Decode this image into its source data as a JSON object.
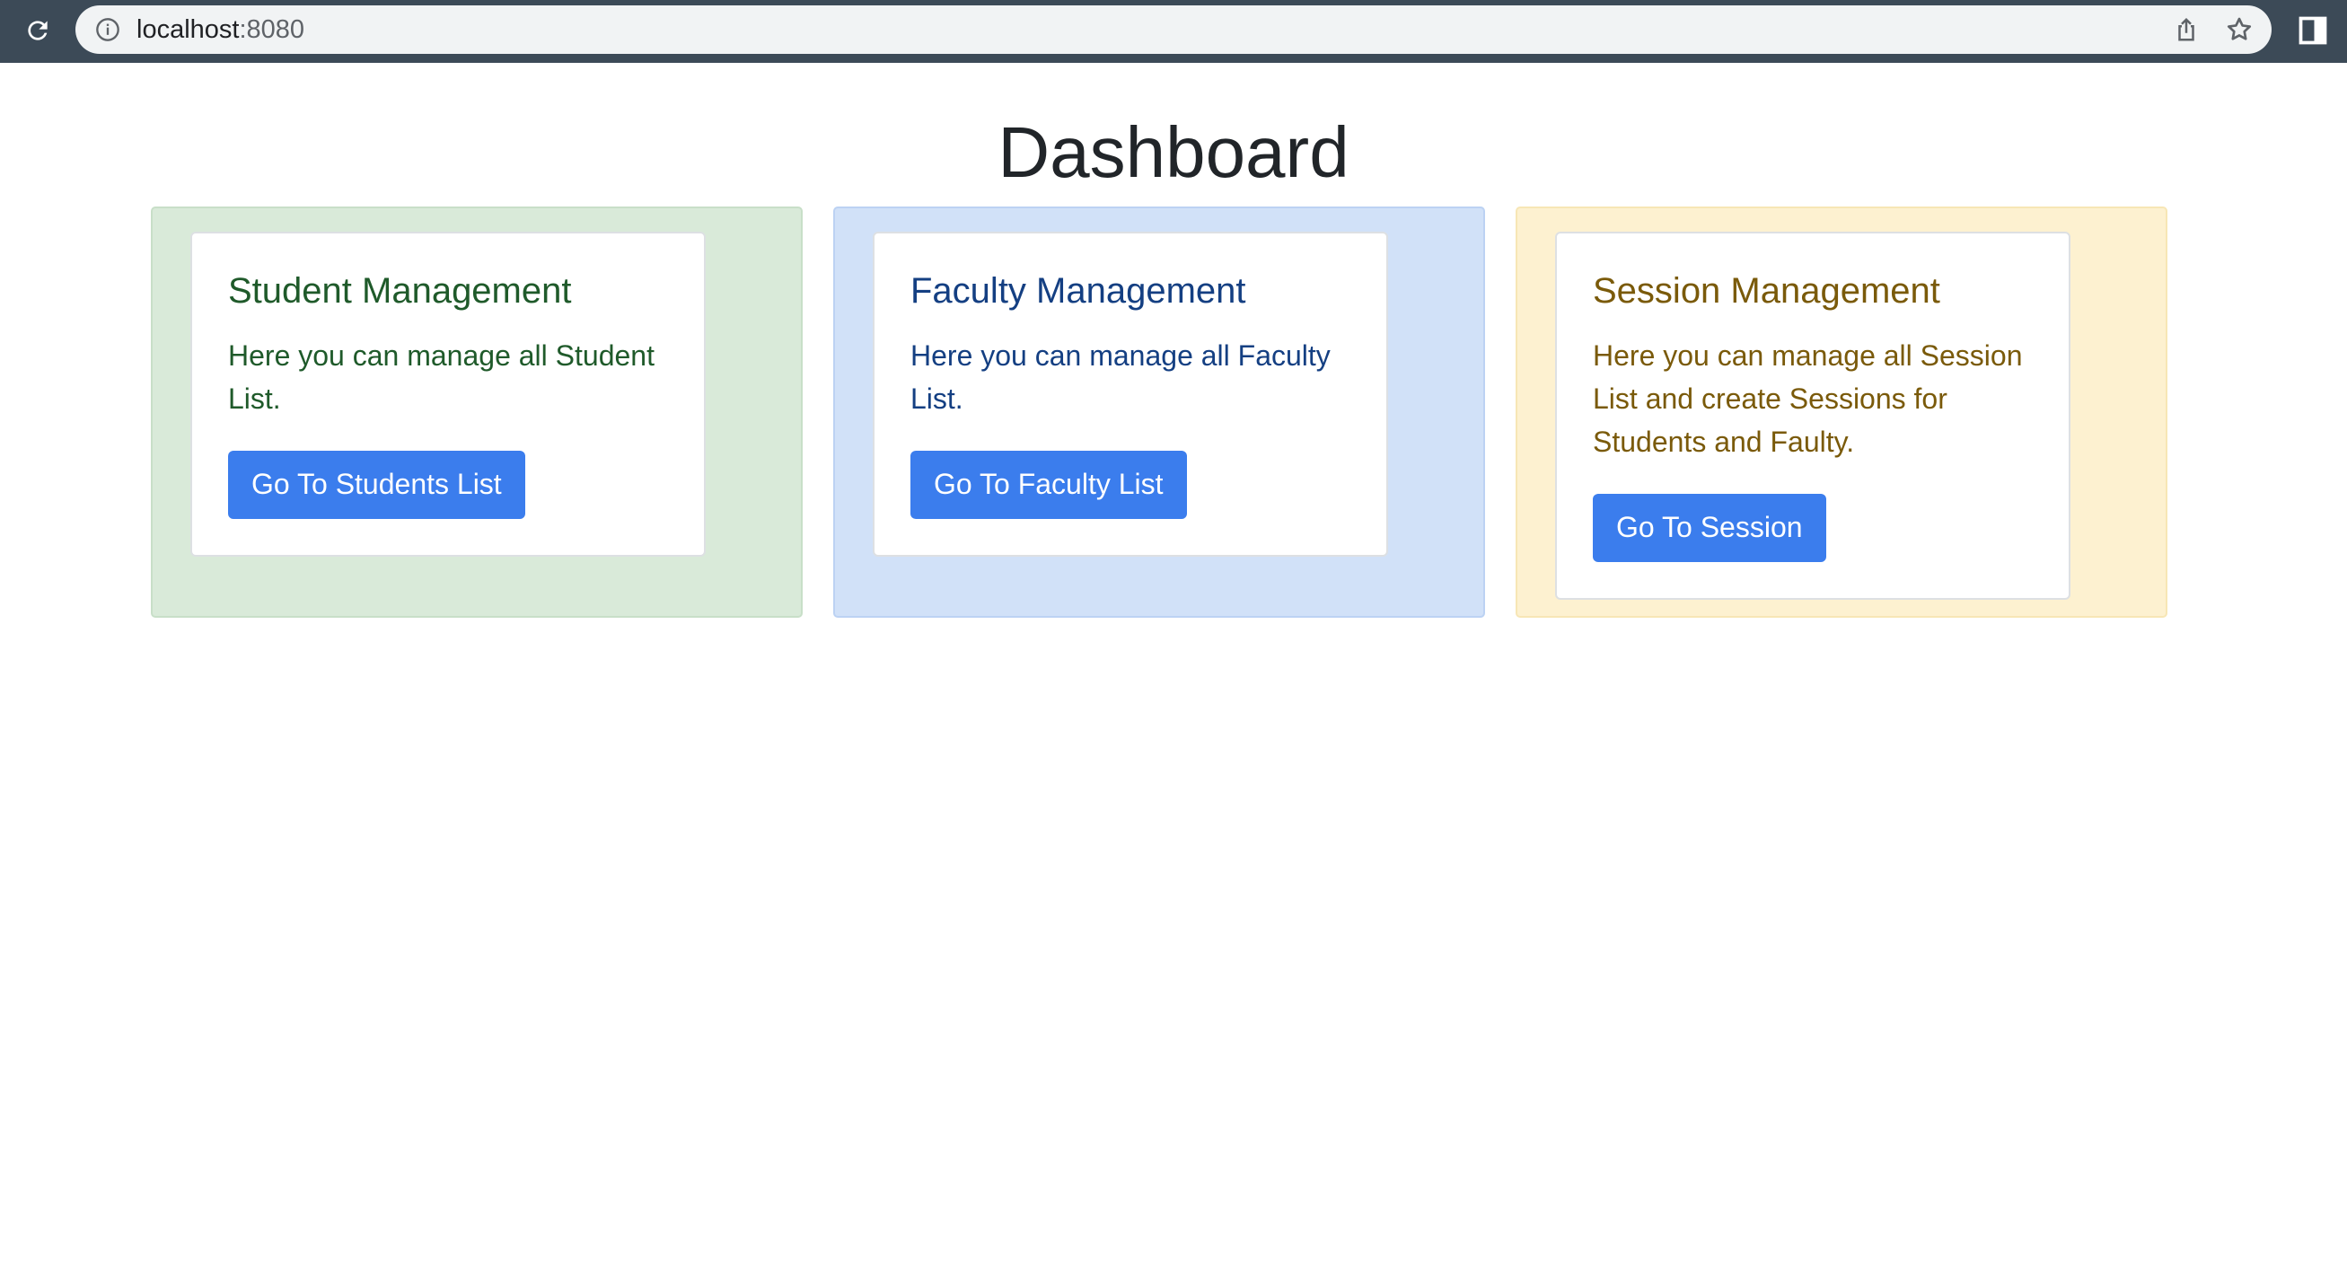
{
  "browser": {
    "url_host": "localhost",
    "url_port": ":8080",
    "icons": [
      "reload-icon",
      "info-icon",
      "share-icon",
      "star-icon",
      "side-panel-icon"
    ]
  },
  "page": {
    "title": "Dashboard",
    "cards": [
      {
        "heading": "Student Management",
        "text": "Here you can manage all Student List.",
        "button_label": "Go To Students List"
      },
      {
        "heading": "Faculty Management",
        "text": "Here you can manage all Faculty List.",
        "button_label": "Go To Faculty List"
      },
      {
        "heading": "Session Management",
        "text": "Here you can manage all Session List and create Sessions for Students and Faulty.",
        "button_label": "Go To Session"
      }
    ]
  },
  "colors": {
    "button": "#3b7ded",
    "green_panel": "#d9ead9",
    "blue_panel": "#d1e1f8",
    "yellow_panel": "#fdf1d0"
  }
}
